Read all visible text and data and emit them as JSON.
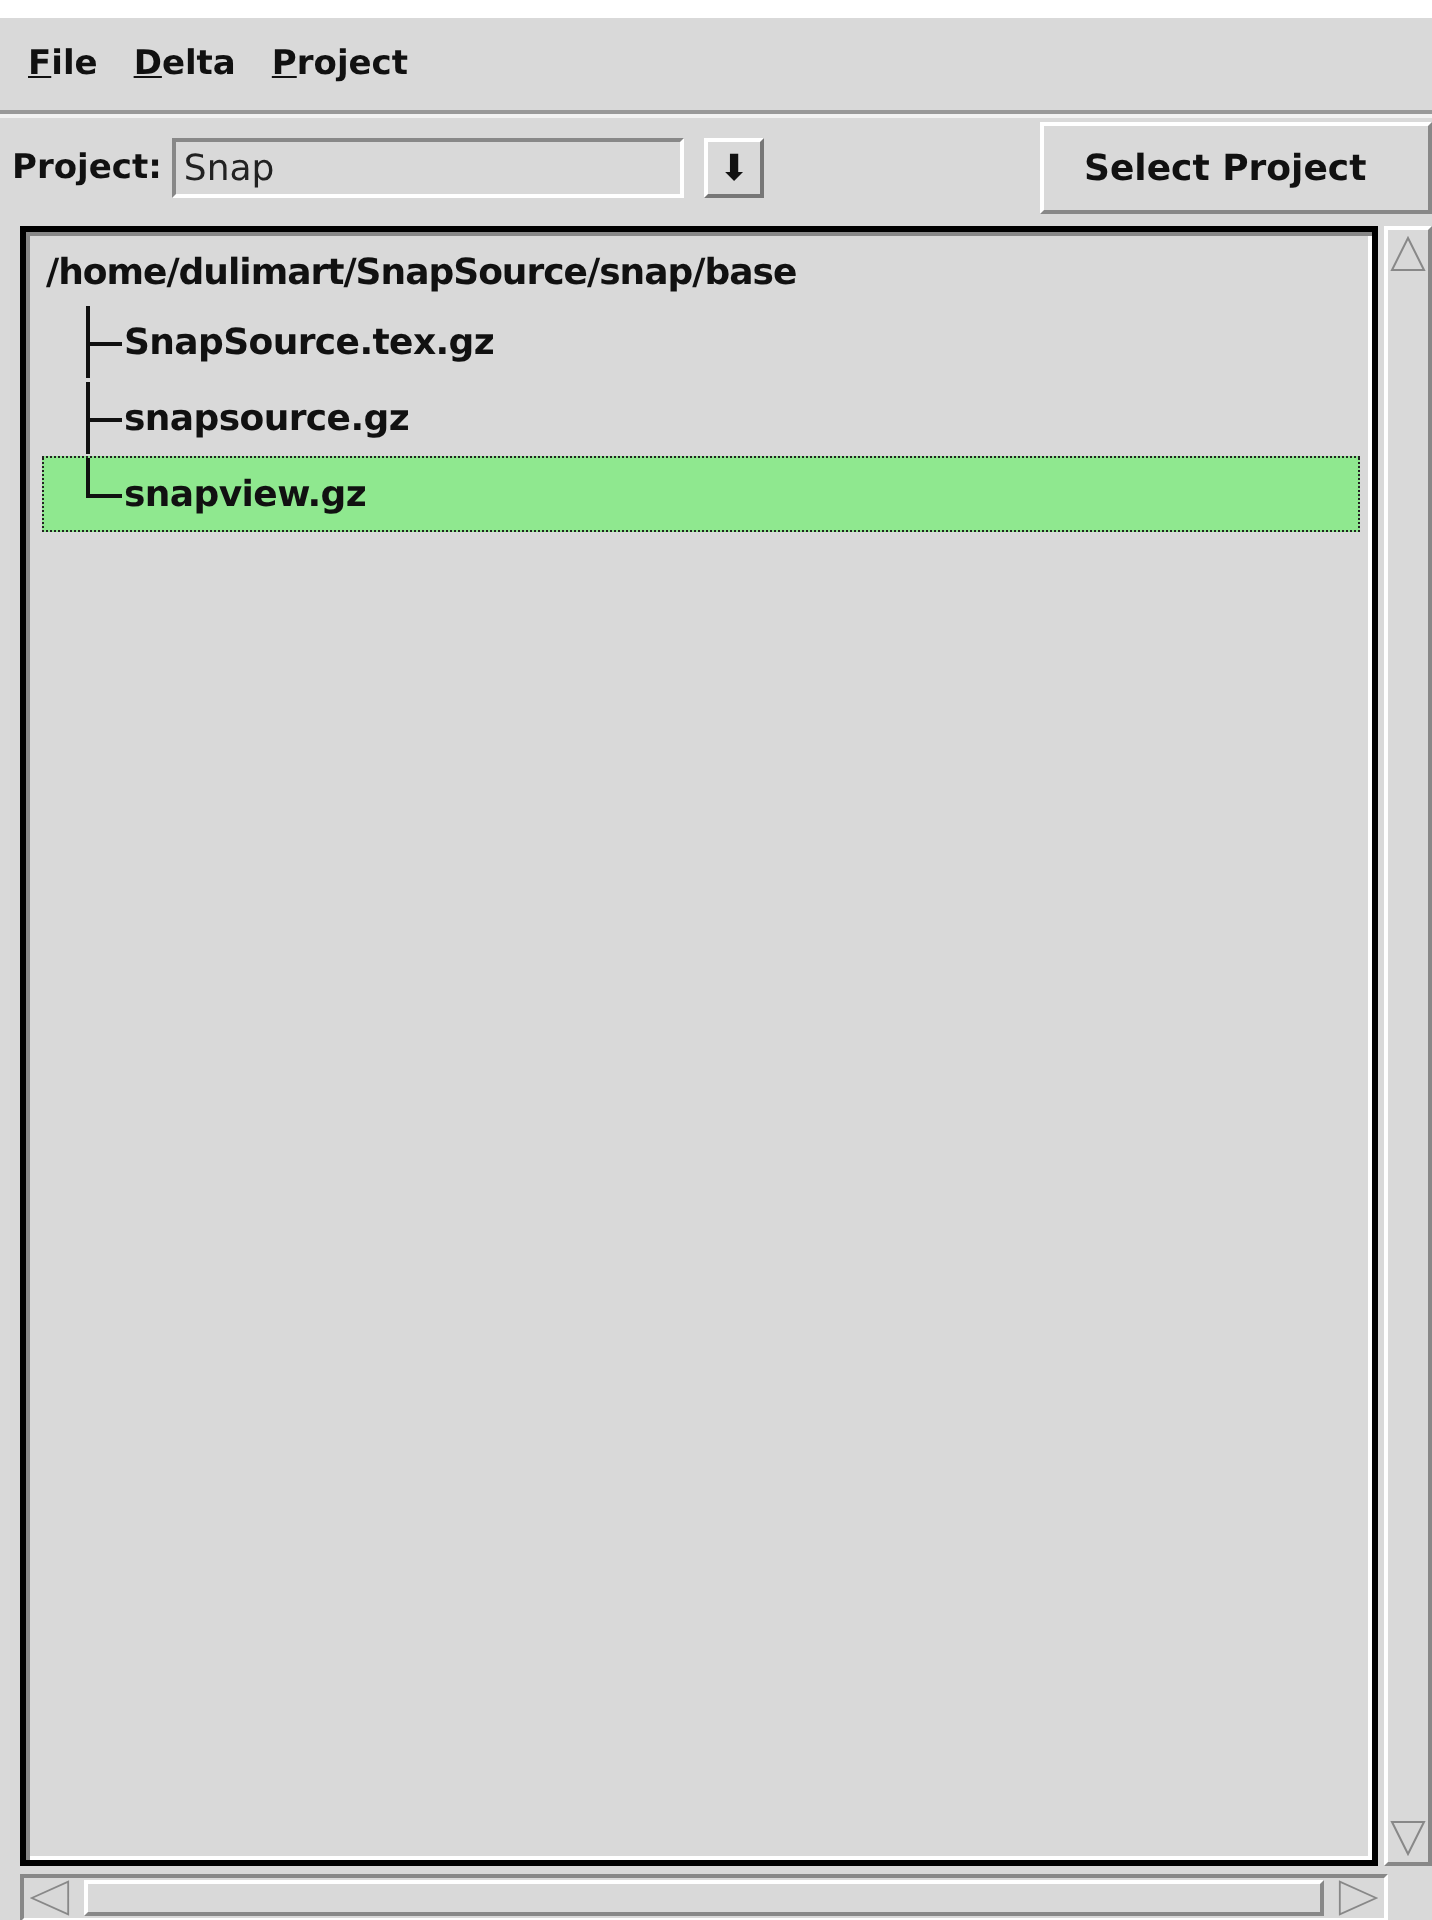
{
  "menu": [
    {
      "label": "File"
    },
    {
      "label": "Delta"
    },
    {
      "label": "Project"
    }
  ],
  "toolbar": {
    "label": "Project:",
    "project_field": {
      "value": "Snap"
    },
    "dropdown_button": "⬇",
    "select_button": "Select Project"
  },
  "tree": {
    "label": "/home/dulimart/SnapSource/snap/base",
    "children": [
      {
        "label": "SnapSource.tex.gz",
        "selected": false
      },
      {
        "label": "snapsource.gz",
        "selected": false
      },
      {
        "label": "snapview.gz",
        "selected": true
      }
    ]
  }
}
